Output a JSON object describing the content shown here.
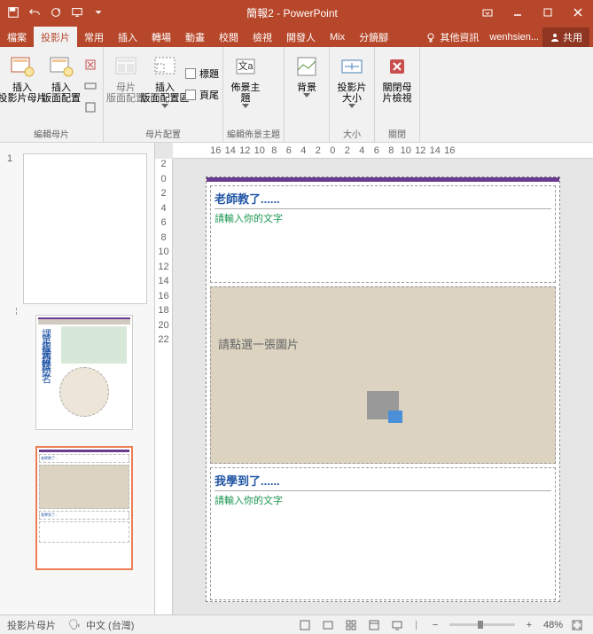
{
  "app_title": "簡報2 - PowerPoint",
  "tabs": {
    "file": "檔案",
    "slides": "投影片",
    "common": "常用",
    "insert": "插入",
    "transition": "轉場",
    "anim": "動畫",
    "review": "校閱",
    "view": "檢視",
    "dev": "開發人",
    "mix": "Mix",
    "mirror": "分鏡腳",
    "other_info": "其他資訊",
    "user": "wenhsien...",
    "share": "共用"
  },
  "ribbon": {
    "g1": {
      "insert_master": "插入\n投影片母片",
      "insert_layout": "插入\n版面配置",
      "label": "編輯母片"
    },
    "g2": {
      "master_layout": "母片\n版面配置",
      "insert_area": "插入\n版面配置區",
      "title": "標題",
      "footer": "頁尾",
      "label": "母片配置"
    },
    "g3": {
      "theme": "佈景主題",
      "label": "編輯佈景主題"
    },
    "g4": {
      "bg": "背景",
      "label": ""
    },
    "g5": {
      "size": "投影片\n大小",
      "label": "大小"
    },
    "g6": {
      "close": "關閉母\n片檢視",
      "label": "關閉"
    }
  },
  "ruler_nums": [
    "16",
    "14",
    "12",
    "10",
    "8",
    "6",
    "4",
    "2",
    "0",
    "2",
    "4",
    "6",
    "8",
    "10",
    "12",
    "14",
    "16"
  ],
  "ruler_v_nums": [
    "2",
    "0",
    "2",
    "4",
    "6",
    "8",
    "10",
    "12",
    "14",
    "16",
    "18",
    "20",
    "22"
  ],
  "slide": {
    "sec1_title": "老師教了......",
    "sec1_hint": "請輸入你的文字",
    "img_hint": "請點選一張圖片",
    "sec2_title": "我學到了......",
    "sec2_hint": "請輸入你的文字"
  },
  "status": {
    "left": "投影片母片",
    "lang": "中文 (台灣)",
    "zoom": "48%"
  },
  "thumb_num": "1"
}
